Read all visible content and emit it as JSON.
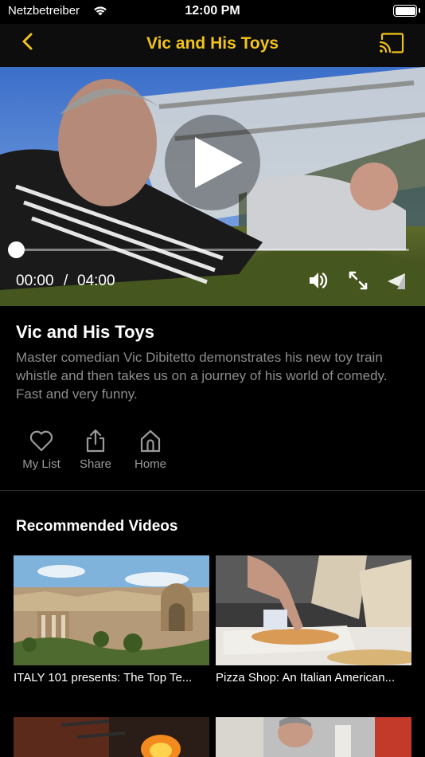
{
  "status_bar": {
    "carrier": "Netzbetreiber",
    "time": "12:00 PM"
  },
  "nav": {
    "title": "Vic and His Toys"
  },
  "player": {
    "current_time": "00:00",
    "separator": "/",
    "duration": "04:00",
    "progress": 0
  },
  "video": {
    "title": "Vic and His Toys",
    "description": "Master comedian Vic Dibitetto demonstrates his new toy train whistle and then takes us on a journey of his world of comedy.  Fast and very funny."
  },
  "actions": [
    {
      "label": "My List",
      "icon": "heart-icon"
    },
    {
      "label": "Share",
      "icon": "share-icon"
    },
    {
      "label": "Home",
      "icon": "home-icon"
    }
  ],
  "recommended": {
    "heading": "Recommended Videos",
    "items": [
      {
        "title": "ITALY 101 presents: The Top Te..."
      },
      {
        "title": "Pizza Shop: An Italian American..."
      },
      {
        "title": ""
      },
      {
        "title": ""
      }
    ]
  },
  "colors": {
    "accent": "#f2c31b",
    "background": "#000000",
    "nav_background": "#0d0d0d",
    "secondary_text": "#8c8c8c"
  }
}
